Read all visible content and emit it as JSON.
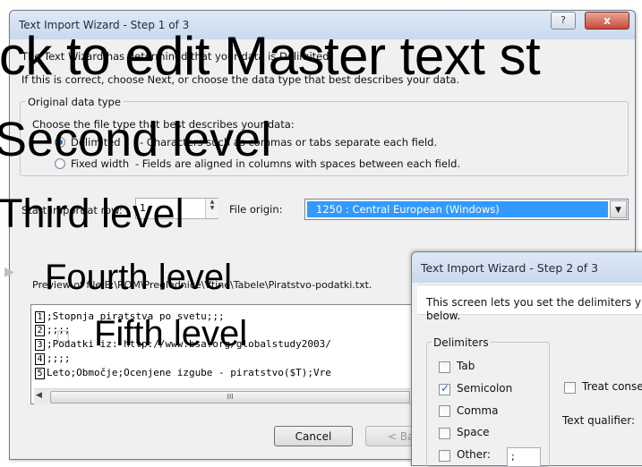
{
  "step1": {
    "title": "Text Import Wizard - Step 1 of 3",
    "help_glyph": "?",
    "close_glyph": "x",
    "intro_line1": "The Text Wizard has determined that your data is Delimited.",
    "intro_line2": "If this is correct, choose Next, or choose the data type that best describes your data.",
    "group_label": "Original data type",
    "choose_label": "Choose the file type that best describes your data:",
    "radio_delimited": "Delimited",
    "radio_delimited_desc": "- Characters such as commas or tabs separate each field.",
    "radio_fixed": "Fixed width",
    "radio_fixed_desc": "- Fields are aligned in columns with spaces between each field.",
    "start_row_label": "Start import at row:",
    "start_row_value": "1",
    "file_origin_label": "File origin:",
    "file_origin_value": "1250 : Central European (Windows)",
    "preview_label": "Preview of file E:\\ROM\\Preglednice\\Vtine\\Tabele\\Piratstvo-podatki.txt.",
    "preview_lines": [
      {
        "num": "1",
        "text": ";Stopnja piratstva po svetu;;;"
      },
      {
        "num": "2",
        "text": ";;;;"
      },
      {
        "num": "3",
        "text": ";Podatki iz: http://www.bsa.org/globalstudy2003/"
      },
      {
        "num": "4",
        "text": ";;;;"
      },
      {
        "num": "5",
        "text": "Leto;Območje;Ocenjene izgube - piratstvo($T);Vre"
      }
    ],
    "scroll_thumb_glyph": "III",
    "cancel_label": "Cancel",
    "back_label": "< Ba"
  },
  "step2": {
    "title": "Text Import Wizard - Step 2 of 3",
    "intro_line1": "This screen lets you set the delimiters y",
    "intro_line2": "below.",
    "delimiters_label": "Delimiters",
    "tab_label": "Tab",
    "semicolon_label": "Semicolon",
    "comma_label": "Comma",
    "space_label": "Space",
    "other_label": "Other:",
    "other_value": ";",
    "treat_label": "Treat conse",
    "qualifier_label": "Text qualifier:"
  },
  "slide_overlay": {
    "level1": "ick to edit Master text st",
    "level2": "Second level",
    "level3": "Third level",
    "level4": "Fourth level",
    "level5": "Fifth level"
  },
  "icons": {
    "bullet4": "triangle-bullet-icon",
    "bullet5": "square-bullet-icon"
  },
  "colors": {
    "selection": "#3399ff",
    "close_button": "#c84a34",
    "titlebar": "#c9d9ee"
  }
}
